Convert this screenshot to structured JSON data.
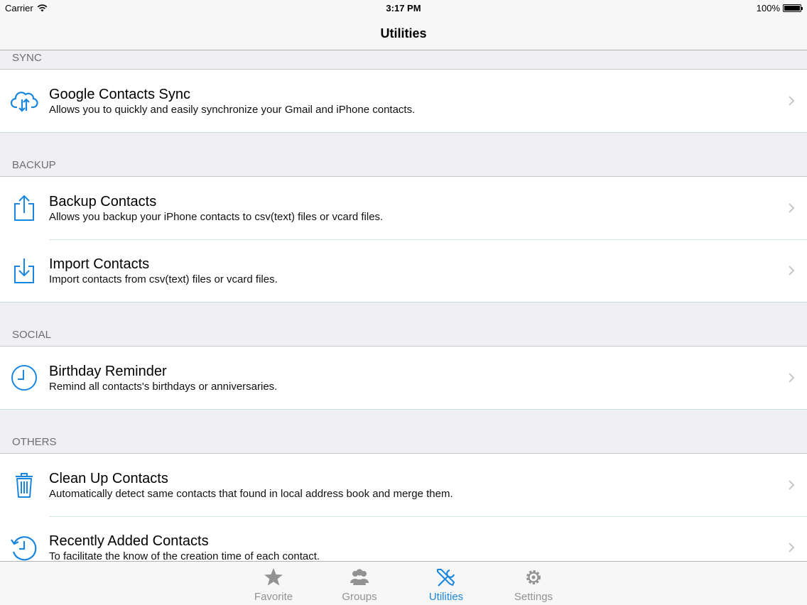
{
  "status_bar": {
    "carrier": "Carrier",
    "time": "3:17 PM",
    "battery": "100%"
  },
  "nav": {
    "title": "Utilities"
  },
  "sections": {
    "sync": {
      "header": "SYNC",
      "items": [
        {
          "title": "Google Contacts Sync",
          "subtitle": "Allows you to quickly and easily synchronize your Gmail and iPhone contacts.",
          "icon": "cloud-sync-icon"
        }
      ]
    },
    "backup": {
      "header": "BACKUP",
      "items": [
        {
          "title": "Backup Contacts",
          "subtitle": "Allows you backup your iPhone contacts to csv(text) files or vcard files.",
          "icon": "export-icon"
        },
        {
          "title": "Import Contacts",
          "subtitle": "Import contacts from csv(text) files or vcard files.",
          "icon": "import-icon"
        }
      ]
    },
    "social": {
      "header": "SOCIAL",
      "items": [
        {
          "title": "Birthday Reminder",
          "subtitle": "Remind all contacts's birthdays or anniversaries.",
          "icon": "clock-icon"
        }
      ]
    },
    "others": {
      "header": "OTHERS",
      "items": [
        {
          "title": "Clean Up Contacts",
          "subtitle": "Automatically detect same contacts that found in local address book and merge them.",
          "icon": "trash-icon"
        },
        {
          "title": "Recently Added Contacts",
          "subtitle": "To facilitate the know of the creation time of each contact.",
          "icon": "history-clock-icon"
        }
      ]
    }
  },
  "tabs": [
    {
      "label": "Favorite",
      "icon": "star-icon",
      "active": false
    },
    {
      "label": "Groups",
      "icon": "groups-icon",
      "active": false
    },
    {
      "label": "Utilities",
      "icon": "tools-icon",
      "active": true
    },
    {
      "label": "Settings",
      "icon": "gear-icon",
      "active": false
    }
  ],
  "colors": {
    "accent": "#1a86e0",
    "tab_inactive": "#929292",
    "group_bg": "#efeff4"
  }
}
